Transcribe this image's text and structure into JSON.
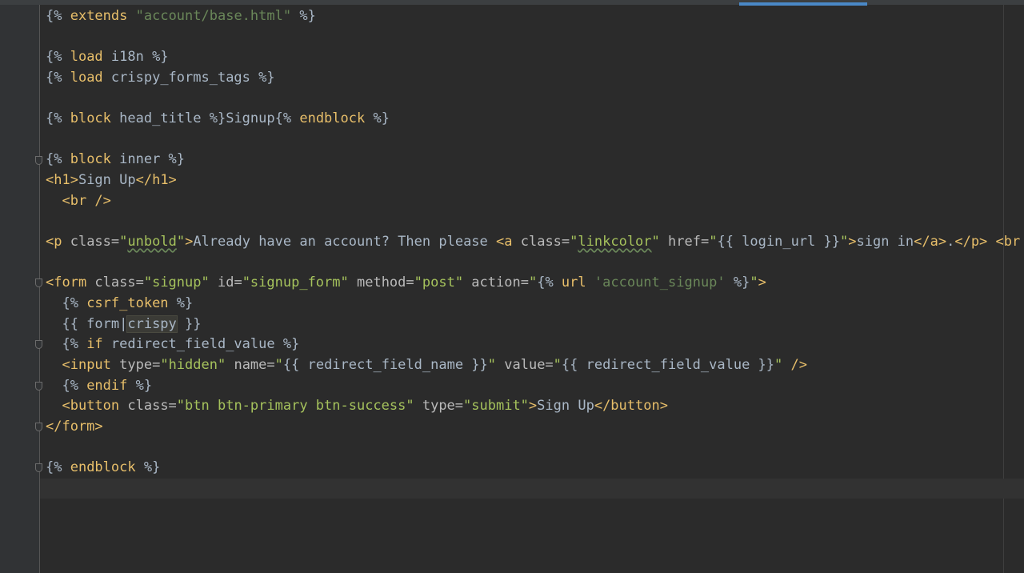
{
  "editor": {
    "lines": [
      [
        {
          "t": "{% ",
          "c": "tb"
        },
        {
          "t": "extends",
          "c": "kw"
        },
        {
          "t": " ",
          "c": "txt"
        },
        {
          "t": "\"account/base.html\"",
          "c": "str"
        },
        {
          "t": " %}",
          "c": "tb"
        }
      ],
      [],
      [
        {
          "t": "{% ",
          "c": "tb"
        },
        {
          "t": "load",
          "c": "kw"
        },
        {
          "t": " i18n %}",
          "c": "tb"
        }
      ],
      [
        {
          "t": "{% ",
          "c": "tb"
        },
        {
          "t": "load",
          "c": "kw"
        },
        {
          "t": " crispy_forms_tags %}",
          "c": "tb"
        }
      ],
      [],
      [
        {
          "t": "{% ",
          "c": "tb"
        },
        {
          "t": "block",
          "c": "kw"
        },
        {
          "t": " head_title %}",
          "c": "tb"
        },
        {
          "t": "Signup",
          "c": "txt"
        },
        {
          "t": "{% ",
          "c": "tb"
        },
        {
          "t": "endblock",
          "c": "kw"
        },
        {
          "t": " %}",
          "c": "tb"
        }
      ],
      [],
      [
        {
          "t": "{% ",
          "c": "tb"
        },
        {
          "t": "block",
          "c": "kw"
        },
        {
          "t": " inner %}",
          "c": "tb"
        }
      ],
      [
        {
          "t": "<h1>",
          "c": "tag"
        },
        {
          "t": "Sign Up",
          "c": "txt"
        },
        {
          "t": "</h1>",
          "c": "tag"
        }
      ],
      [
        {
          "t": "  ",
          "c": "txt"
        },
        {
          "t": "<br />",
          "c": "tag"
        }
      ],
      [],
      [
        {
          "t": "<p ",
          "c": "tag"
        },
        {
          "t": "class=",
          "c": "attr"
        },
        {
          "t": "\"",
          "c": "val"
        },
        {
          "t": "unbold",
          "c": "val",
          "ul": true
        },
        {
          "t": "\"",
          "c": "val"
        },
        {
          "t": ">",
          "c": "tag"
        },
        {
          "t": "Already have an account? Then please ",
          "c": "txt"
        },
        {
          "t": "<a ",
          "c": "tag"
        },
        {
          "t": "class=",
          "c": "attr"
        },
        {
          "t": "\"",
          "c": "val"
        },
        {
          "t": "linkcolor",
          "c": "val",
          "ul": true
        },
        {
          "t": "\"",
          "c": "val"
        },
        {
          "t": " href=",
          "c": "attr"
        },
        {
          "t": "\"",
          "c": "val"
        },
        {
          "t": "{{ login_url }}",
          "c": "tb"
        },
        {
          "t": "\"",
          "c": "val"
        },
        {
          "t": ">",
          "c": "tag"
        },
        {
          "t": "sign in",
          "c": "txt"
        },
        {
          "t": "</a>",
          "c": "tag"
        },
        {
          "t": ".",
          "c": "txt"
        },
        {
          "t": "</p>",
          "c": "tag"
        },
        {
          "t": " ",
          "c": "txt"
        },
        {
          "t": "<br />",
          "c": "tag"
        }
      ],
      [],
      [
        {
          "t": "<form ",
          "c": "tag"
        },
        {
          "t": "class=",
          "c": "attr"
        },
        {
          "t": "\"signup\"",
          "c": "val"
        },
        {
          "t": " id=",
          "c": "attr"
        },
        {
          "t": "\"signup_form\"",
          "c": "val"
        },
        {
          "t": " method=",
          "c": "attr"
        },
        {
          "t": "\"post\"",
          "c": "val"
        },
        {
          "t": " action=",
          "c": "attr"
        },
        {
          "t": "\"",
          "c": "val"
        },
        {
          "t": "{% ",
          "c": "tb"
        },
        {
          "t": "url",
          "c": "kw"
        },
        {
          "t": " ",
          "c": "txt"
        },
        {
          "t": "'account_signup'",
          "c": "str"
        },
        {
          "t": " %}",
          "c": "tb"
        },
        {
          "t": "\"",
          "c": "val"
        },
        {
          "t": ">",
          "c": "tag"
        }
      ],
      [
        {
          "t": "  {% ",
          "c": "tb"
        },
        {
          "t": "csrf_token",
          "c": "kw"
        },
        {
          "t": " %}",
          "c": "tb"
        }
      ],
      [
        {
          "t": "  {{ form|",
          "c": "tb"
        },
        {
          "t": "crispy",
          "c": "tb",
          "hl": true
        },
        {
          "t": " }}",
          "c": "tb"
        }
      ],
      [
        {
          "t": "  {% ",
          "c": "tb"
        },
        {
          "t": "if",
          "c": "kw"
        },
        {
          "t": " redirect_field_value %}",
          "c": "tb"
        }
      ],
      [
        {
          "t": "  ",
          "c": "txt"
        },
        {
          "t": "<input ",
          "c": "tag"
        },
        {
          "t": "type=",
          "c": "attr"
        },
        {
          "t": "\"hidden\"",
          "c": "val"
        },
        {
          "t": " name=",
          "c": "attr"
        },
        {
          "t": "\"",
          "c": "val"
        },
        {
          "t": "{{ redirect_field_name }}",
          "c": "tb"
        },
        {
          "t": "\"",
          "c": "val"
        },
        {
          "t": " value=",
          "c": "attr"
        },
        {
          "t": "\"",
          "c": "val"
        },
        {
          "t": "{{ redirect_field_value }}",
          "c": "tb"
        },
        {
          "t": "\"",
          "c": "val"
        },
        {
          "t": " />",
          "c": "tag"
        }
      ],
      [
        {
          "t": "  {% ",
          "c": "tb"
        },
        {
          "t": "endif",
          "c": "kw"
        },
        {
          "t": " %}",
          "c": "tb"
        }
      ],
      [
        {
          "t": "  ",
          "c": "txt"
        },
        {
          "t": "<button ",
          "c": "tag"
        },
        {
          "t": "class=",
          "c": "attr"
        },
        {
          "t": "\"btn btn-primary btn-success\"",
          "c": "val"
        },
        {
          "t": " type=",
          "c": "attr"
        },
        {
          "t": "\"submit\"",
          "c": "val"
        },
        {
          "t": ">",
          "c": "tag"
        },
        {
          "t": "Sign Up",
          "c": "txt"
        },
        {
          "t": "</button>",
          "c": "tag"
        }
      ],
      [
        {
          "t": "</form>",
          "c": "tag"
        }
      ],
      [],
      [
        {
          "t": "{% ",
          "c": "tb"
        },
        {
          "t": "endblock",
          "c": "kw"
        },
        {
          "t": " %}",
          "c": "tb"
        }
      ],
      []
    ],
    "fold_lines": [
      7,
      13,
      16,
      18,
      20,
      22
    ]
  },
  "colors": {
    "background": "#2b2b2b",
    "gutter": "#313335",
    "tab_indicator": "#4a88c7"
  }
}
